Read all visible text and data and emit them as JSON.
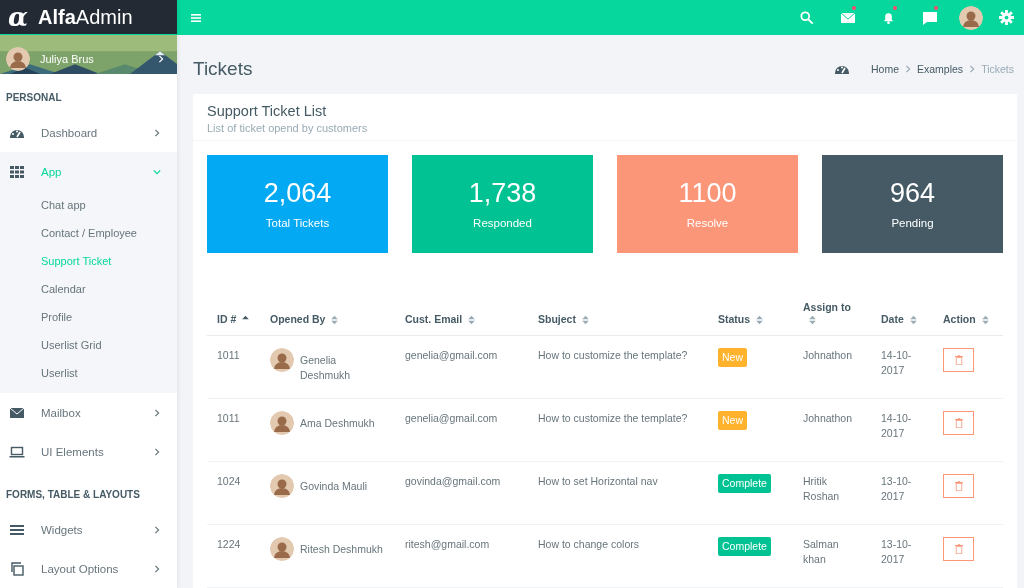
{
  "logo": {
    "mark": "α",
    "text": "**Alfa**Admin"
  },
  "user": {
    "name": "Juliya Brus"
  },
  "topbar": {
    "mail_unread": true,
    "alerts_unread": true,
    "messages_unread": true
  },
  "sidebar": {
    "sections": [
      {
        "heading": "PERSONAL",
        "items": [
          {
            "label": "Dashboard",
            "selected": false,
            "expanded": false
          },
          {
            "label": "App",
            "selected": true,
            "expanded": true,
            "children": [
              {
                "label": "Chat app",
                "selected": false
              },
              {
                "label": "Contact / Employee",
                "selected": false
              },
              {
                "label": "Support Ticket",
                "selected": true
              },
              {
                "label": "Calendar",
                "selected": false
              },
              {
                "label": "Profile",
                "selected": false
              },
              {
                "label": "Userlist Grid",
                "selected": false
              },
              {
                "label": "Userlist",
                "selected": false
              }
            ]
          },
          {
            "label": "Mailbox",
            "selected": false,
            "expanded": false
          },
          {
            "label": "UI Elements",
            "selected": false,
            "expanded": false
          }
        ]
      },
      {
        "heading": "FORMS, TABLE & LAYOUTS",
        "items": [
          {
            "label": "Widgets",
            "selected": false,
            "expanded": false
          },
          {
            "label": "Layout Options",
            "selected": false,
            "expanded": false
          }
        ]
      }
    ]
  },
  "page": {
    "title": "Tickets",
    "breadcrumb": [
      {
        "label": "Home",
        "current": false
      },
      {
        "label": "Examples",
        "current": false
      },
      {
        "label": "Tickets",
        "current": true
      }
    ]
  },
  "card": {
    "title": "Support Ticket List",
    "subtitle": "List of ticket opend by customers",
    "stats": [
      {
        "value": "2,064",
        "label": "Total Tickets",
        "color": "#03a9f3"
      },
      {
        "value": "1,738",
        "label": "Responded",
        "color": "#00c292"
      },
      {
        "value": "1100",
        "label": "Resolve",
        "color": "#fb9678"
      },
      {
        "value": "964",
        "label": "Pending",
        "color": "#455a64"
      }
    ],
    "table": {
      "columns": [
        {
          "label": "ID #",
          "sorted": true
        },
        {
          "label": "Opened By",
          "sorted": false
        },
        {
          "label": "Cust. Email",
          "sorted": false
        },
        {
          "label": "Sbuject",
          "sorted": false
        },
        {
          "label": "Status",
          "sorted": false
        },
        {
          "label": "Assign to",
          "sorted": false
        },
        {
          "label": "Date",
          "sorted": false
        },
        {
          "label": "Action",
          "sorted": false
        }
      ],
      "rows": [
        {
          "id": "1011",
          "name": "Genelia Deshmukh",
          "email": "genelia@gmail.com",
          "subject": "How to customize the template?",
          "status": {
            "label": "New",
            "kind": "new"
          },
          "assignee": "Johnathon",
          "date": "14-10-2017"
        },
        {
          "id": "1011",
          "name": "Ama Deshmukh",
          "email": "genelia@gmail.com",
          "subject": "How to customize the template?",
          "status": {
            "label": "New",
            "kind": "new"
          },
          "assignee": "Johnathon",
          "date": "14-10-2017"
        },
        {
          "id": "1024",
          "name": "Govinda Mauli",
          "email": "govinda@gmail.com",
          "subject": "How to set Horizontal nav",
          "status": {
            "label": "Complete",
            "kind": "complete"
          },
          "assignee": "Hritik Roshan",
          "date": "13-10-2017"
        },
        {
          "id": "1224",
          "name": "Ritesh Deshmukh",
          "email": "ritesh@gmail.com",
          "subject": "How to change colors",
          "status": {
            "label": "Complete",
            "kind": "complete"
          },
          "assignee": "Salman khan",
          "date": "13-10-2017"
        }
      ]
    }
  }
}
